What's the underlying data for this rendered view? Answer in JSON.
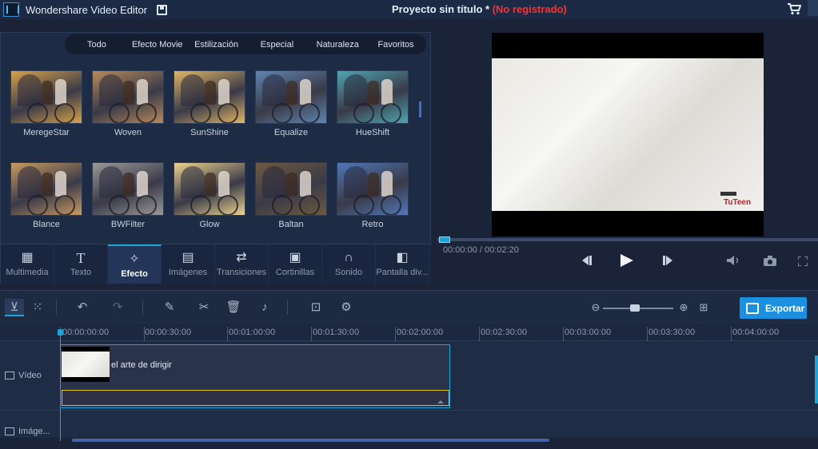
{
  "titlebar": {
    "app_name": "Wondershare Video Editor",
    "project_title": "Proyecto sin título *",
    "project_status": "(No registrado)"
  },
  "library": {
    "filters": [
      {
        "label": "Todo",
        "active": true
      },
      {
        "label": "Efecto Movie",
        "active": false
      },
      {
        "label": "Estilización",
        "active": false
      },
      {
        "label": "Especial",
        "active": false
      },
      {
        "label": "Naturaleza",
        "active": false
      },
      {
        "label": "Favoritos",
        "active": false
      }
    ],
    "effects": [
      {
        "label": "MeregeStar",
        "tint": "#d9a24a"
      },
      {
        "label": "Woven",
        "tint": "#b88a5a"
      },
      {
        "label": "SunShine",
        "tint": "#e2b766"
      },
      {
        "label": "Equalize",
        "tint": "#5f86b0"
      },
      {
        "label": "HueShift",
        "tint": "#4fa6b2"
      },
      {
        "label": "Blance",
        "tint": "#c99a62"
      },
      {
        "label": "BWFilter",
        "tint": "#9a9a9a"
      },
      {
        "label": "Glow",
        "tint": "#edd58f"
      },
      {
        "label": "Baltan",
        "tint": "#6d5a3f"
      },
      {
        "label": "Retro",
        "tint": "#4f78b8"
      }
    ],
    "tool_tabs": [
      {
        "label": "Multimedia",
        "icon": "film-strip-icon",
        "active": false
      },
      {
        "label": "Texto",
        "icon": "text-icon",
        "active": false
      },
      {
        "label": "Efecto",
        "icon": "magic-wand-icon",
        "active": true
      },
      {
        "label": "Imágenes",
        "icon": "image-film-icon",
        "active": false
      },
      {
        "label": "Transiciones",
        "icon": "transition-icon",
        "active": false
      },
      {
        "label": "Cortinillas",
        "icon": "clapper-icon",
        "active": false
      },
      {
        "label": "Sonido",
        "icon": "headphones-icon",
        "active": false
      },
      {
        "label": "Pantalla div...",
        "icon": "split-screen-icon",
        "active": false
      }
    ]
  },
  "preview": {
    "time": "00:00:00 / 00:02:20",
    "watermark": "TuTeen",
    "progress": 0
  },
  "timeline": {
    "export_label": "Exportar",
    "ruler": [
      "00:00:00:00",
      "00:00:30:00",
      "00:01:00:00",
      "00:01:30:00",
      "00:02:00:00",
      "00:02:30:00",
      "00:03:00:00",
      "00:03:30:00",
      "00:04:00:00"
    ],
    "tracks": {
      "video_label": "Vídeo",
      "image_label": "Imáge..."
    },
    "clip_title": "el arte de dirigir"
  },
  "colors": {
    "accent": "#1aa5d6",
    "status_red": "#ff3030",
    "audio_border": "#e0c21a",
    "export": "#1b8fe0"
  }
}
